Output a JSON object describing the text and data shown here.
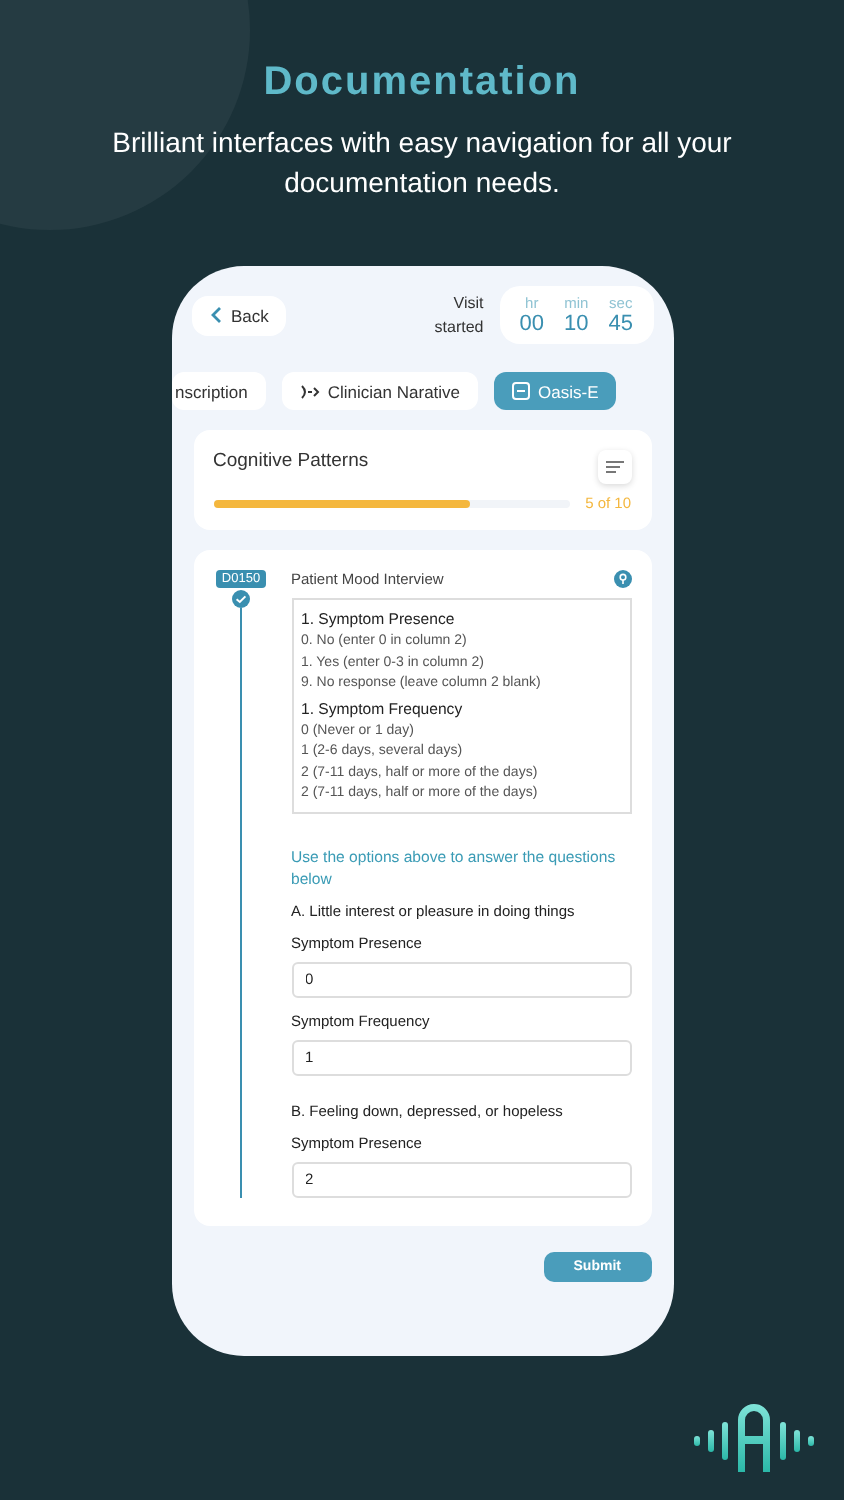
{
  "hero": {
    "title": "Documentation",
    "subtitle": "Brilliant interfaces with easy navigation for all your documentation needs."
  },
  "visit": {
    "back_label": "Back",
    "label": "Visit started",
    "timer": [
      {
        "unit": "hr",
        "value": "00"
      },
      {
        "unit": "min",
        "value": "10"
      },
      {
        "unit": "sec",
        "value": "45"
      }
    ]
  },
  "tabs": [
    {
      "label": "nscription",
      "selected": false
    },
    {
      "label": "Clinician Narative",
      "selected": false
    },
    {
      "label": "Oasis-E",
      "selected": true
    }
  ],
  "section": {
    "title": "Cognitive Patterns",
    "level": 0.72,
    "progress_text": "5 of 10"
  },
  "question": {
    "code": "D0150",
    "completed": true,
    "title": "Patient Mood Interview",
    "legend": [
      {
        "title": "1. Symptom Presence",
        "lines": [
          "0. No (enter 0 in column 2)",
          "1. Yes (enter 0-3 in column 2)",
          "9. No response (leave column 2 blank)"
        ]
      },
      {
        "title": "1. Symptom Frequency",
        "lines": [
          "0 (Never or 1 day)",
          "1 (2-6 days, several days)",
          "2 (7-11 days, half or more of the days)",
          "2 (7-11 days, half or more of the days)"
        ]
      }
    ],
    "instruction": "Use the options above to answer the questions below",
    "items": [
      {
        "prompt": "A. Little interest or pleasure in doing things",
        "fields": [
          {
            "label": "Symptom Presence",
            "value": "0"
          },
          {
            "label": "Symptom Frequency",
            "value": "1"
          }
        ]
      },
      {
        "prompt": "B. Feeling down, depressed, or hopeless",
        "fields": [
          {
            "label": "Symptom Presence",
            "value": "2"
          }
        ]
      }
    ]
  },
  "submit": "Submit"
}
